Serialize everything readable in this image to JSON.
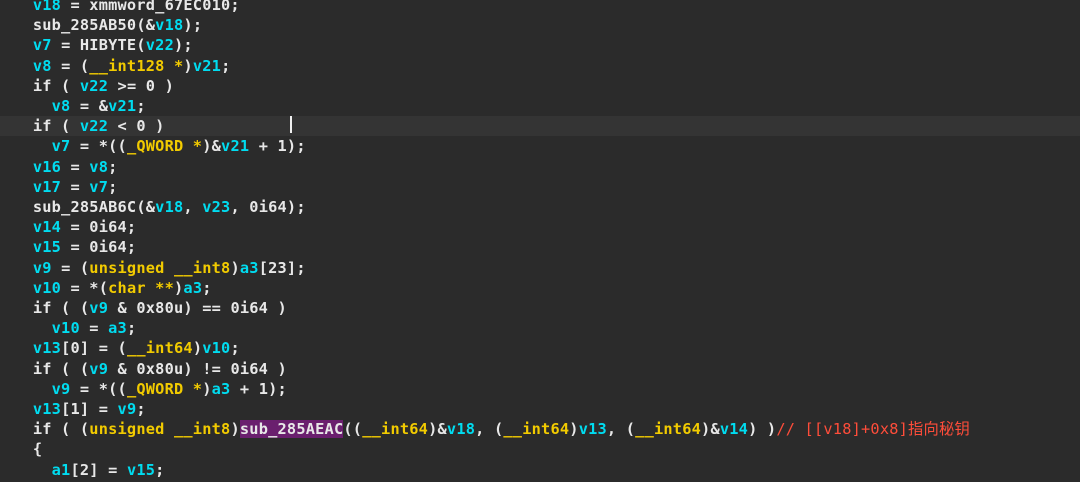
{
  "editor": {
    "lines": [
      {
        "indent": "  ",
        "tokens": [
          [
            "var",
            "v18"
          ],
          [
            "plain",
            " = xmmword_67EC010;"
          ]
        ]
      },
      {
        "indent": "  ",
        "tokens": [
          [
            "func",
            "sub_285AB50"
          ],
          [
            "plain",
            "(&"
          ],
          [
            "var",
            "v18"
          ],
          [
            "plain",
            ");"
          ]
        ]
      },
      {
        "indent": "  ",
        "tokens": [
          [
            "var",
            "v7"
          ],
          [
            "plain",
            " = HIBYTE("
          ],
          [
            "var",
            "v22"
          ],
          [
            "plain",
            ");"
          ]
        ]
      },
      {
        "indent": "  ",
        "tokens": [
          [
            "var",
            "v8"
          ],
          [
            "plain",
            " = ("
          ],
          [
            "type",
            "__int128 *"
          ],
          [
            "plain",
            ")"
          ],
          [
            "var",
            "v21"
          ],
          [
            "plain",
            ";"
          ]
        ]
      },
      {
        "indent": "  ",
        "tokens": [
          [
            "plain",
            "if ( "
          ],
          [
            "var",
            "v22"
          ],
          [
            "plain",
            " >= 0 )"
          ]
        ]
      },
      {
        "indent": "    ",
        "tokens": [
          [
            "var",
            "v8"
          ],
          [
            "plain",
            " = &"
          ],
          [
            "var",
            "v21"
          ],
          [
            "plain",
            ";"
          ]
        ]
      },
      {
        "indent": "  ",
        "tokens": [
          [
            "plain",
            "if ( "
          ],
          [
            "var",
            "v22"
          ],
          [
            "plain",
            " < 0 )"
          ]
        ],
        "highlight": true
      },
      {
        "indent": "    ",
        "tokens": [
          [
            "var",
            "v7"
          ],
          [
            "plain",
            " = *(("
          ],
          [
            "type",
            "_QWORD *"
          ],
          [
            "plain",
            ")&"
          ],
          [
            "var",
            "v21"
          ],
          [
            "plain",
            " + 1);"
          ]
        ]
      },
      {
        "indent": "  ",
        "tokens": [
          [
            "var",
            "v16"
          ],
          [
            "plain",
            " = "
          ],
          [
            "var",
            "v8"
          ],
          [
            "plain",
            ";"
          ]
        ]
      },
      {
        "indent": "  ",
        "tokens": [
          [
            "var",
            "v17"
          ],
          [
            "plain",
            " = "
          ],
          [
            "var",
            "v7"
          ],
          [
            "plain",
            ";"
          ]
        ]
      },
      {
        "indent": "  ",
        "tokens": [
          [
            "func",
            "sub_285AB6C"
          ],
          [
            "plain",
            "(&"
          ],
          [
            "var",
            "v18"
          ],
          [
            "plain",
            ", "
          ],
          [
            "var",
            "v23"
          ],
          [
            "plain",
            ", 0i64);"
          ]
        ]
      },
      {
        "indent": "  ",
        "tokens": [
          [
            "var",
            "v14"
          ],
          [
            "plain",
            " = 0i64;"
          ]
        ]
      },
      {
        "indent": "  ",
        "tokens": [
          [
            "var",
            "v15"
          ],
          [
            "plain",
            " = 0i64;"
          ]
        ]
      },
      {
        "indent": "  ",
        "tokens": [
          [
            "var",
            "v9"
          ],
          [
            "plain",
            " = ("
          ],
          [
            "type",
            "unsigned __int8"
          ],
          [
            "plain",
            ")"
          ],
          [
            "var",
            "a3"
          ],
          [
            "plain",
            "[23];"
          ]
        ]
      },
      {
        "indent": "  ",
        "tokens": [
          [
            "var",
            "v10"
          ],
          [
            "plain",
            " = *("
          ],
          [
            "type",
            "char **"
          ],
          [
            "plain",
            ")"
          ],
          [
            "var",
            "a3"
          ],
          [
            "plain",
            ";"
          ]
        ]
      },
      {
        "indent": "  ",
        "tokens": [
          [
            "plain",
            "if ( ("
          ],
          [
            "var",
            "v9"
          ],
          [
            "plain",
            " & 0x80u) == 0i64 )"
          ]
        ]
      },
      {
        "indent": "    ",
        "tokens": [
          [
            "var",
            "v10"
          ],
          [
            "plain",
            " = "
          ],
          [
            "var",
            "a3"
          ],
          [
            "plain",
            ";"
          ]
        ]
      },
      {
        "indent": "  ",
        "tokens": [
          [
            "var",
            "v13"
          ],
          [
            "plain",
            "[0] = ("
          ],
          [
            "type",
            "__int64"
          ],
          [
            "plain",
            ")"
          ],
          [
            "var",
            "v10"
          ],
          [
            "plain",
            ";"
          ]
        ]
      },
      {
        "indent": "  ",
        "tokens": [
          [
            "plain",
            "if ( ("
          ],
          [
            "var",
            "v9"
          ],
          [
            "plain",
            " & 0x80u) != 0i64 )"
          ]
        ]
      },
      {
        "indent": "    ",
        "tokens": [
          [
            "var",
            "v9"
          ],
          [
            "plain",
            " = *(("
          ],
          [
            "type",
            "_QWORD *"
          ],
          [
            "plain",
            ")"
          ],
          [
            "var",
            "a3"
          ],
          [
            "plain",
            " + 1);"
          ]
        ]
      },
      {
        "indent": "  ",
        "tokens": [
          [
            "var",
            "v13"
          ],
          [
            "plain",
            "[1] = "
          ],
          [
            "var",
            "v9"
          ],
          [
            "plain",
            ";"
          ]
        ]
      },
      {
        "indent": "  ",
        "tokens": [
          [
            "plain",
            "if ( ("
          ],
          [
            "type",
            "unsigned __int8"
          ],
          [
            "plain",
            ")"
          ],
          [
            "sfunc",
            "sub_285AEAC"
          ],
          [
            "plain",
            "(("
          ],
          [
            "type",
            "__int64"
          ],
          [
            "plain",
            ")&"
          ],
          [
            "var",
            "v18"
          ],
          [
            "plain",
            ", ("
          ],
          [
            "type",
            "__int64"
          ],
          [
            "plain",
            ")"
          ],
          [
            "var",
            "v13"
          ],
          [
            "plain",
            ", ("
          ],
          [
            "type",
            "__int64"
          ],
          [
            "plain",
            ")&"
          ],
          [
            "var",
            "v14"
          ],
          [
            "plain",
            ") )"
          ],
          [
            "cmt",
            "// [[v18]+0x8]指向秘钥"
          ]
        ]
      },
      {
        "indent": "  ",
        "tokens": [
          [
            "plain",
            "{"
          ]
        ]
      },
      {
        "indent": "    ",
        "tokens": [
          [
            "var",
            "a1"
          ],
          [
            "plain",
            "[2] = "
          ],
          [
            "var",
            "v15"
          ],
          [
            "plain",
            ";"
          ]
        ]
      }
    ],
    "colors": {
      "background": "#2b2b2b",
      "variable": "#00dcf0",
      "type": "#f2cb00",
      "plain": "#e8e8e8",
      "comment": "#ff4d3a",
      "selected_function_bg": "#6a1f6e"
    }
  }
}
